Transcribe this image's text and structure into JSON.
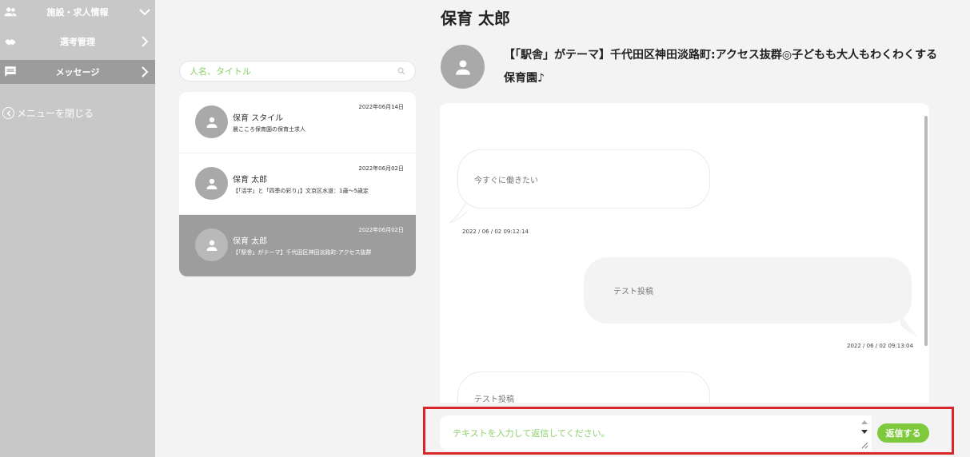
{
  "sidebar": {
    "items": [
      {
        "label": "施設・求人情報",
        "icon": "people-icon"
      },
      {
        "label": "選考管理",
        "icon": "handshake-icon"
      },
      {
        "label": "メッセージ",
        "icon": "message-icon"
      }
    ],
    "close_label": "メニューを閉じる"
  },
  "search": {
    "placeholder": "人名、タイトル"
  },
  "threads": [
    {
      "name": "保育 スタイル",
      "subtitle": "晨こころ保育園の保育士求人",
      "date": "2022年06月14日"
    },
    {
      "name": "保育 太郎",
      "subtitle": "【「活字」と「四季の彩り」】文京区水道：1歳〜5歳定",
      "date": "2022年06月02日"
    },
    {
      "name": "保育 太郎",
      "subtitle": "【「駅舎」がテーマ】千代田区神田淡路町:アクセス抜群",
      "date": "2022年06月02日"
    }
  ],
  "header": {
    "person_name": "保育 太郎",
    "job_title": "【「駅舎」がテーマ】千代田区神田淡路町:アクセス抜群◎子どもも大人もわくわくする保育園♪"
  },
  "messages": [
    {
      "text": "今すぐに働きたい",
      "time": "2022 / 06 / 02 09:12:14"
    },
    {
      "text": "テスト投稿",
      "time": "2022 / 06 / 02 09:13:04"
    },
    {
      "text": "テスト投稿"
    }
  ],
  "reply": {
    "placeholder": "テキストを入力して返信してください。",
    "send_label": "返信する"
  },
  "colors": {
    "accent": "#7fc93c",
    "highlight": "#d9262a",
    "sidebar": "#c8c8c8"
  }
}
